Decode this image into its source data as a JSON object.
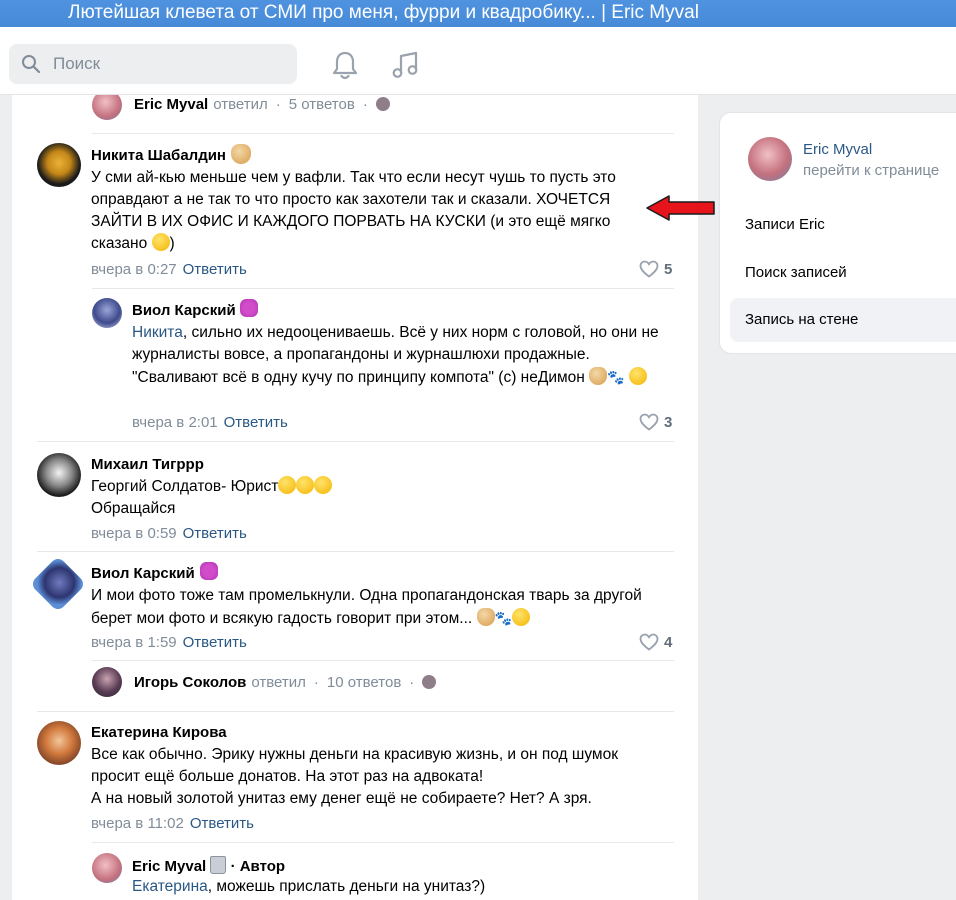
{
  "window": {
    "title": "Лютейшая клевета от СМИ про меня, фурри и квадробику... | Eric Myval"
  },
  "topbar": {
    "search_placeholder": "Поиск",
    "icons": [
      "search-icon",
      "bell-icon",
      "music-icon"
    ]
  },
  "comments": [
    {
      "thread": {
        "name": "Eric Myval",
        "verb": "ответил",
        "count": "5 ответов"
      }
    },
    {
      "author": "Никита Шабалдин",
      "text": "У сми ай-кью меньше чем у вафли. Так что если несут чушь то пусть это оправдают а не так то что просто как захотели так и сказали. ХОЧЕТСЯ ЗАЙТИ В ИХ ОФИС И КАЖДОГО ПОРВАТЬ НА КУСКИ (и это ещё мягко сказано",
      "time": "вчера в 0:27",
      "reply_label": "Ответить",
      "likes": "5"
    },
    {
      "author": "Виол Карский",
      "mention": "Никита",
      "text": ", сильно их недооцениваешь. Всё у них норм с головой, но они не журналисты вовсе, а пропагандоны и журнашлюхи продажные. \"Сваливают всё в одну кучу по принципу компота\" (с) неДимон",
      "time": "вчера в 2:01",
      "reply_label": "Ответить",
      "likes": "3"
    },
    {
      "author": "Михаил Тигррр",
      "text_line1": "Георгий Солдатов- Юрист",
      "text_line2": "Обращайся",
      "time": "вчера в 0:59",
      "reply_label": "Ответить"
    },
    {
      "author": "Виол Карский",
      "text": "И мои фото тоже там промелькнули. Одна пропагандонская тварь за другой берет мои фото и всякую гадость говорит при этом...",
      "time": "вчера в 1:59",
      "reply_label": "Ответить",
      "likes": "4",
      "thread": {
        "name": "Игорь Соколов",
        "verb": "ответил",
        "count": "10 ответов"
      }
    },
    {
      "author": "Екатерина Кирова",
      "text": "Все как обычно. Эрику нужны деньги на красивую жизнь, и он под шумок просит ещё больше донатов. На этот раз на адвоката!",
      "text2": "А на новый золотой унитаз ему денег ещё не собираете? Нет? А зря.",
      "time": "вчера в 11:02",
      "reply_label": "Ответить"
    },
    {
      "author": "Eric Myval",
      "badge": "· Автор",
      "mention": "Екатерина",
      "text": ", можешь прислать деньги на унитаз?)"
    }
  ],
  "sidebar": {
    "profile_name": "Eric Myval",
    "profile_sub": "перейти к странице",
    "items": [
      "Записи Eric",
      "Поиск записей",
      "Запись на стене"
    ],
    "active_index": 2
  },
  "colors": {
    "link": "#2a5885",
    "meta": "#818c99",
    "annotation_arrow": "#e8141c",
    "titlebar": "#4a8edd"
  }
}
